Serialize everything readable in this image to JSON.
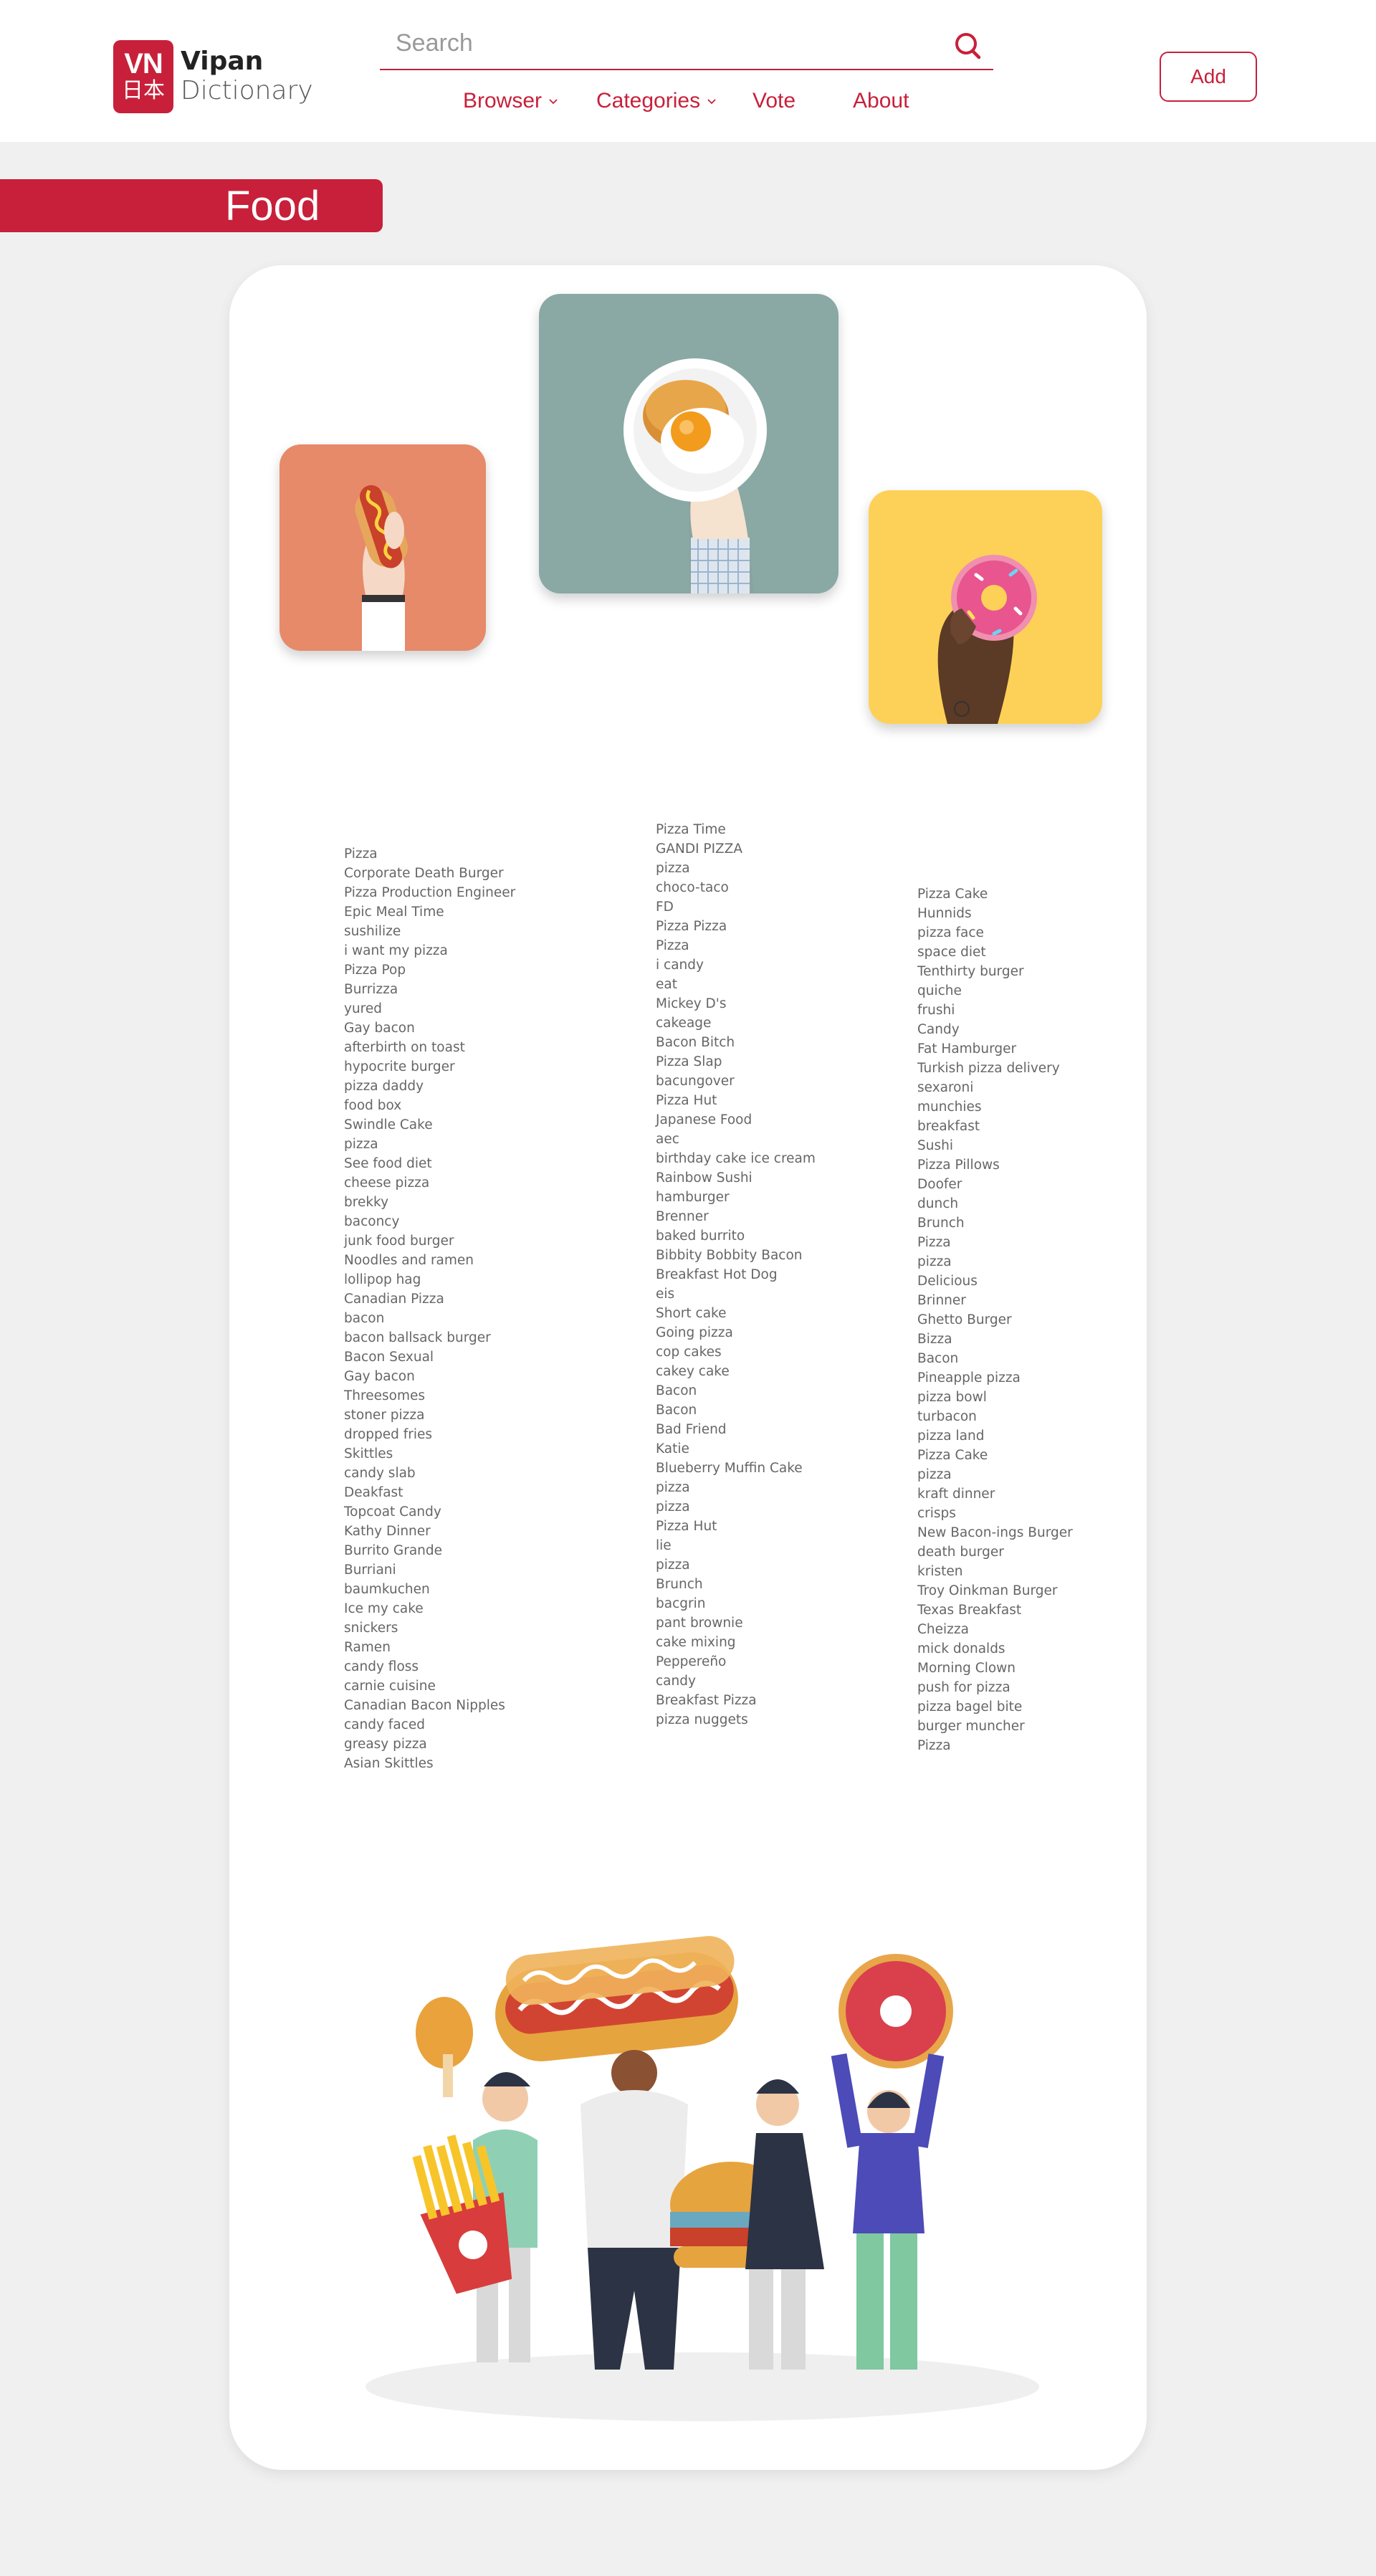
{
  "logo": {
    "badge_top": "VN",
    "badge_bottom": "日本",
    "name": "Vipan",
    "subtitle": "Dictionary"
  },
  "search": {
    "placeholder": "Search",
    "value": "",
    "icon": "search-icon"
  },
  "nav": [
    {
      "label": "Browser",
      "has_dropdown": true
    },
    {
      "label": "Categories",
      "has_dropdown": true
    },
    {
      "label": "Vote",
      "has_dropdown": false
    },
    {
      "label": "About",
      "has_dropdown": false
    }
  ],
  "add_button": "Add",
  "category_title": "Food",
  "colors": {
    "brand": "#c8203a",
    "page_bg": "#f0f0f0",
    "card_bg": "#ffffff",
    "text": "#666666"
  },
  "illustrations": [
    "hand-holding-hotdog",
    "hand-holding-fried-egg-plate",
    "hand-holding-donut",
    "people-carrying-fast-food"
  ],
  "columns": [
    [
      "Pizza",
      "Corporate Death Burger",
      "Pizza Production Engineer",
      "Epic Meal Time",
      "sushilize",
      "i want my pizza",
      "Pizza Pop",
      "Burrizza",
      "yured",
      "Gay bacon",
      "afterbirth on toast",
      "hypocrite burger",
      "pizza daddy",
      "food box",
      "Swindle Cake",
      "pizza",
      "See food diet",
      "cheese pizza",
      "brekky",
      "baconcy",
      "junk food burger",
      "Noodles and ramen",
      "lollipop hag",
      "Canadian Pizza",
      "bacon",
      "bacon ballsack burger",
      "Bacon Sexual",
      "Gay bacon",
      "Threesomes",
      "stoner pizza",
      "dropped fries",
      "Skittles",
      "candy slab",
      "Deakfast",
      "Topcoat Candy",
      "Kathy Dinner",
      "Burrito Grande",
      "Burriani",
      "baumkuchen",
      "Ice my cake",
      "snickers",
      "Ramen",
      "candy floss",
      "carnie cuisine",
      "Canadian Bacon Nipples",
      "candy faced",
      "greasy pizza",
      "Asian Skittles"
    ],
    [
      "Pizza Time",
      "GANDI PIZZA",
      "pizza",
      "choco-taco",
      "FD",
      "Pizza Pizza",
      "Pizza",
      "i candy",
      "eat",
      "Mickey D's",
      "cakeage",
      "Bacon Bitch",
      "Pizza Slap",
      "bacungover",
      "Pizza Hut",
      "Japanese Food",
      "aec",
      "birthday cake ice cream",
      "Rainbow Sushi",
      "hamburger",
      "Brenner",
      "baked burrito",
      "Bibbity Bobbity Bacon",
      "Breakfast Hot Dog",
      "eis",
      "Short cake",
      "Going pizza",
      "cop cakes",
      "cakey cake",
      "Bacon",
      "Bacon",
      "Bad Friend",
      "Katie",
      "Blueberry Muffin Cake",
      "pizza",
      "pizza",
      "Pizza Hut",
      "lie",
      "pizza",
      "Brunch",
      "bacgrin",
      "pant brownie",
      "cake mixing",
      "Peppereño",
      "candy",
      "Breakfast Pizza",
      "pizza nuggets"
    ],
    [
      "Pizza Cake",
      "Hunnids",
      "pizza face",
      "space diet",
      "Tenthirty burger",
      "quiche",
      "frushi",
      "Candy",
      "Fat Hamburger",
      "Turkish pizza delivery",
      "sexaroni",
      "munchies",
      "breakfast",
      "Sushi",
      "Pizza Pillows",
      "Doofer",
      "dunch",
      "Brunch",
      "Pizza",
      "pizza",
      "Delicious",
      "Brinner",
      "Ghetto Burger",
      "Bizza",
      "Bacon",
      "Pineapple pizza",
      "pizza bowl",
      "turbacon",
      "pizza land",
      "Pizza Cake",
      "pizza",
      "kraft dinner",
      "crisps",
      "New Bacon-ings Burger",
      "death burger",
      "kristen",
      "Troy Oinkman Burger",
      "Texas Breakfast",
      "Cheizza",
      "mick donalds",
      "Morning Clown",
      "push for pizza",
      "pizza bagel bite",
      "burger muncher",
      "Pizza"
    ]
  ]
}
